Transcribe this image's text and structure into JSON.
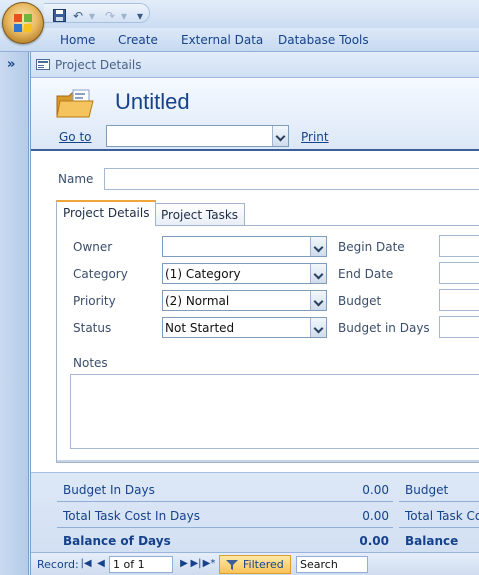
{
  "ribbon": {
    "tabs": [
      "Home",
      "Create",
      "External Data",
      "Database Tools"
    ]
  },
  "quick_access": {
    "icons": [
      "save-icon",
      "undo-icon",
      "redo-icon",
      "customize-icon"
    ]
  },
  "document_tab": {
    "title": "Project Details"
  },
  "form_header": {
    "title": "Untitled",
    "goto_label": "Go to",
    "goto_value": "",
    "print_label": "Print"
  },
  "form": {
    "name_label": "Name",
    "name_value": "",
    "tabs": [
      {
        "label": "Project Details",
        "active": true
      },
      {
        "label": "Project Tasks",
        "active": false
      }
    ],
    "fields": {
      "owner_label": "Owner",
      "owner_value": "",
      "category_label": "Category",
      "category_value": "(1) Category",
      "priority_label": "Priority",
      "priority_value": "(2) Normal",
      "status_label": "Status",
      "status_value": "Not Started",
      "begin_date_label": "Begin Date",
      "end_date_label": "End Date",
      "budget_label": "Budget",
      "budget_days_label": "Budget in Days",
      "notes_label": "Notes"
    }
  },
  "footer": {
    "rows": [
      {
        "label": "Budget In Days",
        "value": "0.00",
        "right_label": "Budget"
      },
      {
        "label": "Total Task Cost In Days",
        "value": "0.00",
        "right_label": "Total Task Co"
      },
      {
        "label": "Balance of Days",
        "value": "0.00",
        "right_label": "Balance"
      }
    ]
  },
  "record_nav": {
    "label": "Record:",
    "position": "1 of 1",
    "filter_label": "Filtered",
    "search_placeholder": "Search"
  },
  "colors": {
    "accent": "#15428b",
    "tab_highlight": "#f0a43c",
    "filter_bg": "#f9c35a"
  }
}
